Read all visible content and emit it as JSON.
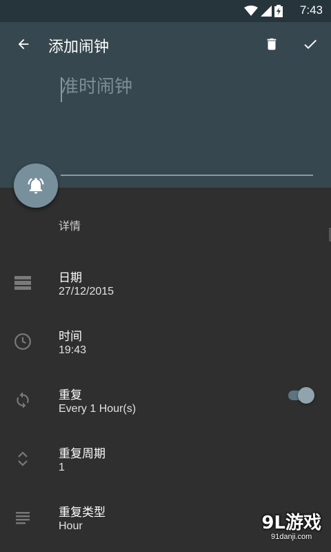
{
  "status_bar": {
    "time": "7:43"
  },
  "toolbar": {
    "title": "添加闹钟",
    "back_icon": "arrow-back-icon",
    "delete_icon": "delete-icon",
    "confirm_icon": "check-icon"
  },
  "name_field": {
    "placeholder": "准时闹钟",
    "value": ""
  },
  "details_label": "详情",
  "rows": [
    {
      "title": "日期",
      "value": "27/12/2015",
      "icon": "calendar-icon"
    },
    {
      "title": "时间",
      "value": "19:43",
      "icon": "clock-icon"
    },
    {
      "title": "重复",
      "value": "Every 1 Hour(s)",
      "icon": "repeat-icon",
      "toggle_on": true
    },
    {
      "title": "重复周期",
      "value": "1",
      "icon": "expand-icon"
    },
    {
      "title": "重复类型",
      "value": "Hour",
      "icon": "list-icon"
    }
  ],
  "watermark": {
    "brand": "9L游戏",
    "url": "91danji.com"
  },
  "colors": {
    "header": "#37474f",
    "status_bar": "#26343c",
    "background": "#2f2f2f",
    "accent": "#78909c"
  }
}
